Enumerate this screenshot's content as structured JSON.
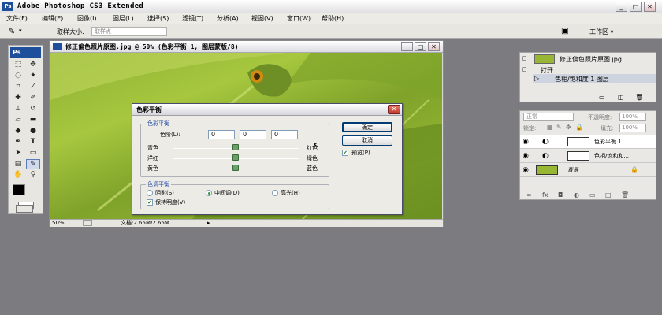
{
  "app": {
    "title": "Adobe Photoshop CS3 Extended",
    "logo": "Ps"
  },
  "window_controls": {
    "minimize": "_",
    "restore": "□",
    "close": "✕"
  },
  "menu": [
    "文件(F)",
    "编辑(E)",
    "图像(I)",
    "图层(L)",
    "选择(S)",
    "滤镜(T)",
    "分析(A)",
    "视图(V)",
    "窗口(W)",
    "帮助(H)"
  ],
  "options": {
    "sample_size_label": "取样大小:",
    "sample_size_value": "取样点",
    "workspace_label": "工作区 ▾"
  },
  "toolbox": {
    "badge": "Ps"
  },
  "document": {
    "title": "修正偏色照片原图.jpg @ 50% (色彩平衡 1, 图层蒙版/8)",
    "zoom": "50%",
    "doc_info": "文档:2.65M/2.65M"
  },
  "history": {
    "snapshot": "修正偏色照片原图.jpg",
    "items": [
      "打开",
      "色相/饱和度 1 图层"
    ]
  },
  "layers": {
    "blend_mode": "正常",
    "opacity_label": "不透明度:",
    "opacity_value": "100%",
    "lock_label": "锁定:",
    "fill_label": "填充:",
    "fill_value": "100%",
    "items": [
      {
        "name": "色彩平衡 1"
      },
      {
        "name": "色相/饱和和..."
      },
      {
        "name": "背景"
      }
    ]
  },
  "dialog": {
    "title": "色彩平衡",
    "balance_group": "色彩平衡",
    "levels_label": "色阶(L):",
    "levels": [
      "0",
      "0",
      "0"
    ],
    "sliders": [
      {
        "left": "青色",
        "right": "红色",
        "value": 0
      },
      {
        "left": "洋红",
        "right": "绿色",
        "value": 0
      },
      {
        "left": "黄色",
        "right": "蓝色",
        "value": 0
      }
    ],
    "tone_group": "色调平衡",
    "tones": [
      "阴影(S)",
      "中间调(D)",
      "高光(H)"
    ],
    "selected_tone": "中间调(D)",
    "preserve": "保持明度(V)",
    "ok": "确定",
    "cancel": "取消",
    "preview": "预览(P)"
  }
}
